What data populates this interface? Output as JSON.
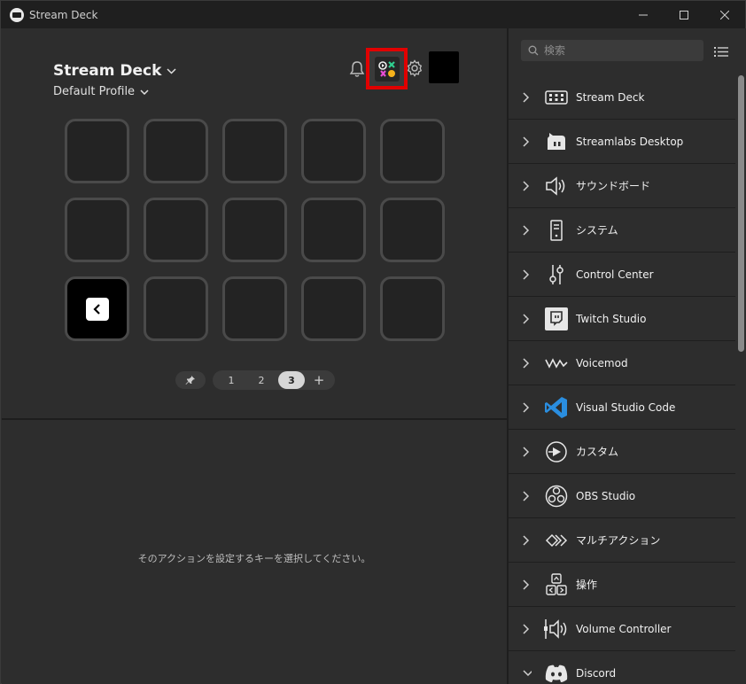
{
  "window": {
    "title": "Stream Deck"
  },
  "header": {
    "device_name": "Stream Deck",
    "profile_name": "Default Profile"
  },
  "pager": {
    "pages": [
      "1",
      "2",
      "3"
    ],
    "active_page": "3",
    "add_label": "+"
  },
  "hint": {
    "text": "そのアクションを設定するキーを選択してください。"
  },
  "search": {
    "placeholder": "検索"
  },
  "categories": [
    {
      "label": "Stream Deck",
      "icon": "stream-deck-icon",
      "expanded": false
    },
    {
      "label": "Streamlabs Desktop",
      "icon": "streamlabs-icon",
      "expanded": false
    },
    {
      "label": "サウンドボード",
      "icon": "speaker-icon",
      "expanded": false
    },
    {
      "label": "システム",
      "icon": "system-icon",
      "expanded": false
    },
    {
      "label": "Control Center",
      "icon": "sliders-icon",
      "expanded": false
    },
    {
      "label": "Twitch Studio",
      "icon": "twitch-icon",
      "expanded": false
    },
    {
      "label": "Voicemod",
      "icon": "voicemod-icon",
      "expanded": false
    },
    {
      "label": "Visual Studio Code",
      "icon": "vscode-icon",
      "expanded": false
    },
    {
      "label": "カスタム",
      "icon": "custom-icon",
      "expanded": false
    },
    {
      "label": "OBS Studio",
      "icon": "obs-icon",
      "expanded": false
    },
    {
      "label": "マルチアクション",
      "icon": "multi-action-icon",
      "expanded": false
    },
    {
      "label": "操作",
      "icon": "navigation-icon",
      "expanded": false
    },
    {
      "label": "Volume Controller",
      "icon": "volume-controller-icon",
      "expanded": false
    },
    {
      "label": "Discord",
      "icon": "discord-icon",
      "expanded": true
    }
  ],
  "colors": {
    "highlight_border": "#e10000",
    "background": "#2d2d2d",
    "titlebar": "#1f1f1f",
    "vscode_blue": "#2a8ee0"
  }
}
